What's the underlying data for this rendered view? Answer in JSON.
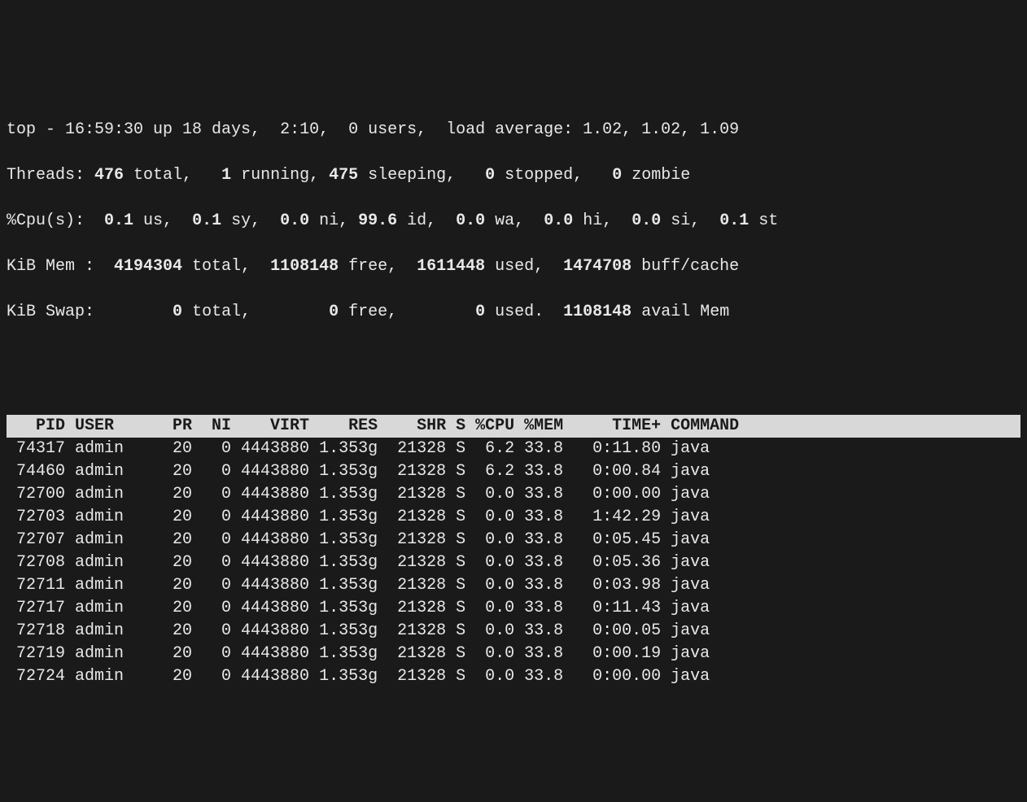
{
  "summary": {
    "line1": {
      "prefix": "top - ",
      "time": "16:59:30",
      "uptime_prefix": " up ",
      "uptime": "18 days,  2:10",
      "users_sep": ",  ",
      "users": "0 users",
      "load_prefix": ",  load average: ",
      "load": "1.02, 1.02, 1.09"
    },
    "line2": {
      "label": "Threads:",
      "total_val": " 476 ",
      "total_lbl": "total,   ",
      "running_val": "1 ",
      "running_lbl": "running, ",
      "sleeping_val": "475 ",
      "sleeping_lbl": "sleeping,   ",
      "stopped_val": "0 ",
      "stopped_lbl": "stopped,   ",
      "zombie_val": "0 ",
      "zombie_lbl": "zombie"
    },
    "line3": {
      "label": "%Cpu(s): ",
      "us_val": " 0.1 ",
      "us_lbl": "us, ",
      "sy_val": " 0.1 ",
      "sy_lbl": "sy, ",
      "ni_val": " 0.0 ",
      "ni_lbl": "ni, ",
      "id_val": "99.6 ",
      "id_lbl": "id, ",
      "wa_val": " 0.0 ",
      "wa_lbl": "wa, ",
      "hi_val": " 0.0 ",
      "hi_lbl": "hi, ",
      "si_val": " 0.0 ",
      "si_lbl": "si, ",
      "st_val": " 0.1 ",
      "st_lbl": "st"
    },
    "line4": {
      "label": "KiB Mem :  ",
      "total_val": "4194304 ",
      "total_lbl": "total,  ",
      "free_val": "1108148 ",
      "free_lbl": "free,  ",
      "used_val": "1611448 ",
      "used_lbl": "used,  ",
      "buff_val": "1474708 ",
      "buff_lbl": "buff/cache"
    },
    "line5": {
      "label": "KiB Swap:        ",
      "total_val": "0 ",
      "total_lbl": "total,        ",
      "free_val": "0 ",
      "free_lbl": "free,        ",
      "used_val": "0 ",
      "used_lbl": "used.  ",
      "avail_val": "1108148 ",
      "avail_lbl": "avail Mem"
    }
  },
  "columns_header": "   PID USER      PR  NI    VIRT    RES    SHR S %CPU %MEM     TIME+ COMMAND                  ",
  "processes": [
    {
      "pid": "74317",
      "user": "admin",
      "pr": "20",
      "ni": "0",
      "virt": "4443880",
      "res": "1.353g",
      "shr": "21328",
      "s": "S",
      "cpu": "6.2",
      "mem": "33.8",
      "time": "0:11.80",
      "command": "java"
    },
    {
      "pid": "74460",
      "user": "admin",
      "pr": "20",
      "ni": "0",
      "virt": "4443880",
      "res": "1.353g",
      "shr": "21328",
      "s": "S",
      "cpu": "6.2",
      "mem": "33.8",
      "time": "0:00.84",
      "command": "java"
    },
    {
      "pid": "72700",
      "user": "admin",
      "pr": "20",
      "ni": "0",
      "virt": "4443880",
      "res": "1.353g",
      "shr": "21328",
      "s": "S",
      "cpu": "0.0",
      "mem": "33.8",
      "time": "0:00.00",
      "command": "java"
    },
    {
      "pid": "72703",
      "user": "admin",
      "pr": "20",
      "ni": "0",
      "virt": "4443880",
      "res": "1.353g",
      "shr": "21328",
      "s": "S",
      "cpu": "0.0",
      "mem": "33.8",
      "time": "1:42.29",
      "command": "java"
    },
    {
      "pid": "72707",
      "user": "admin",
      "pr": "20",
      "ni": "0",
      "virt": "4443880",
      "res": "1.353g",
      "shr": "21328",
      "s": "S",
      "cpu": "0.0",
      "mem": "33.8",
      "time": "0:05.45",
      "command": "java"
    },
    {
      "pid": "72708",
      "user": "admin",
      "pr": "20",
      "ni": "0",
      "virt": "4443880",
      "res": "1.353g",
      "shr": "21328",
      "s": "S",
      "cpu": "0.0",
      "mem": "33.8",
      "time": "0:05.36",
      "command": "java"
    },
    {
      "pid": "72711",
      "user": "admin",
      "pr": "20",
      "ni": "0",
      "virt": "4443880",
      "res": "1.353g",
      "shr": "21328",
      "s": "S",
      "cpu": "0.0",
      "mem": "33.8",
      "time": "0:03.98",
      "command": "java"
    },
    {
      "pid": "72717",
      "user": "admin",
      "pr": "20",
      "ni": "0",
      "virt": "4443880",
      "res": "1.353g",
      "shr": "21328",
      "s": "S",
      "cpu": "0.0",
      "mem": "33.8",
      "time": "0:11.43",
      "command": "java"
    },
    {
      "pid": "72718",
      "user": "admin",
      "pr": "20",
      "ni": "0",
      "virt": "4443880",
      "res": "1.353g",
      "shr": "21328",
      "s": "S",
      "cpu": "0.0",
      "mem": "33.8",
      "time": "0:00.05",
      "command": "java"
    },
    {
      "pid": "72719",
      "user": "admin",
      "pr": "20",
      "ni": "0",
      "virt": "4443880",
      "res": "1.353g",
      "shr": "21328",
      "s": "S",
      "cpu": "0.0",
      "mem": "33.8",
      "time": "0:00.19",
      "command": "java"
    },
    {
      "pid": "72724",
      "user": "admin",
      "pr": "20",
      "ni": "0",
      "virt": "4443880",
      "res": "1.353g",
      "shr": "21328",
      "s": "S",
      "cpu": "0.0",
      "mem": "33.8",
      "time": "0:00.00",
      "command": "java"
    }
  ]
}
